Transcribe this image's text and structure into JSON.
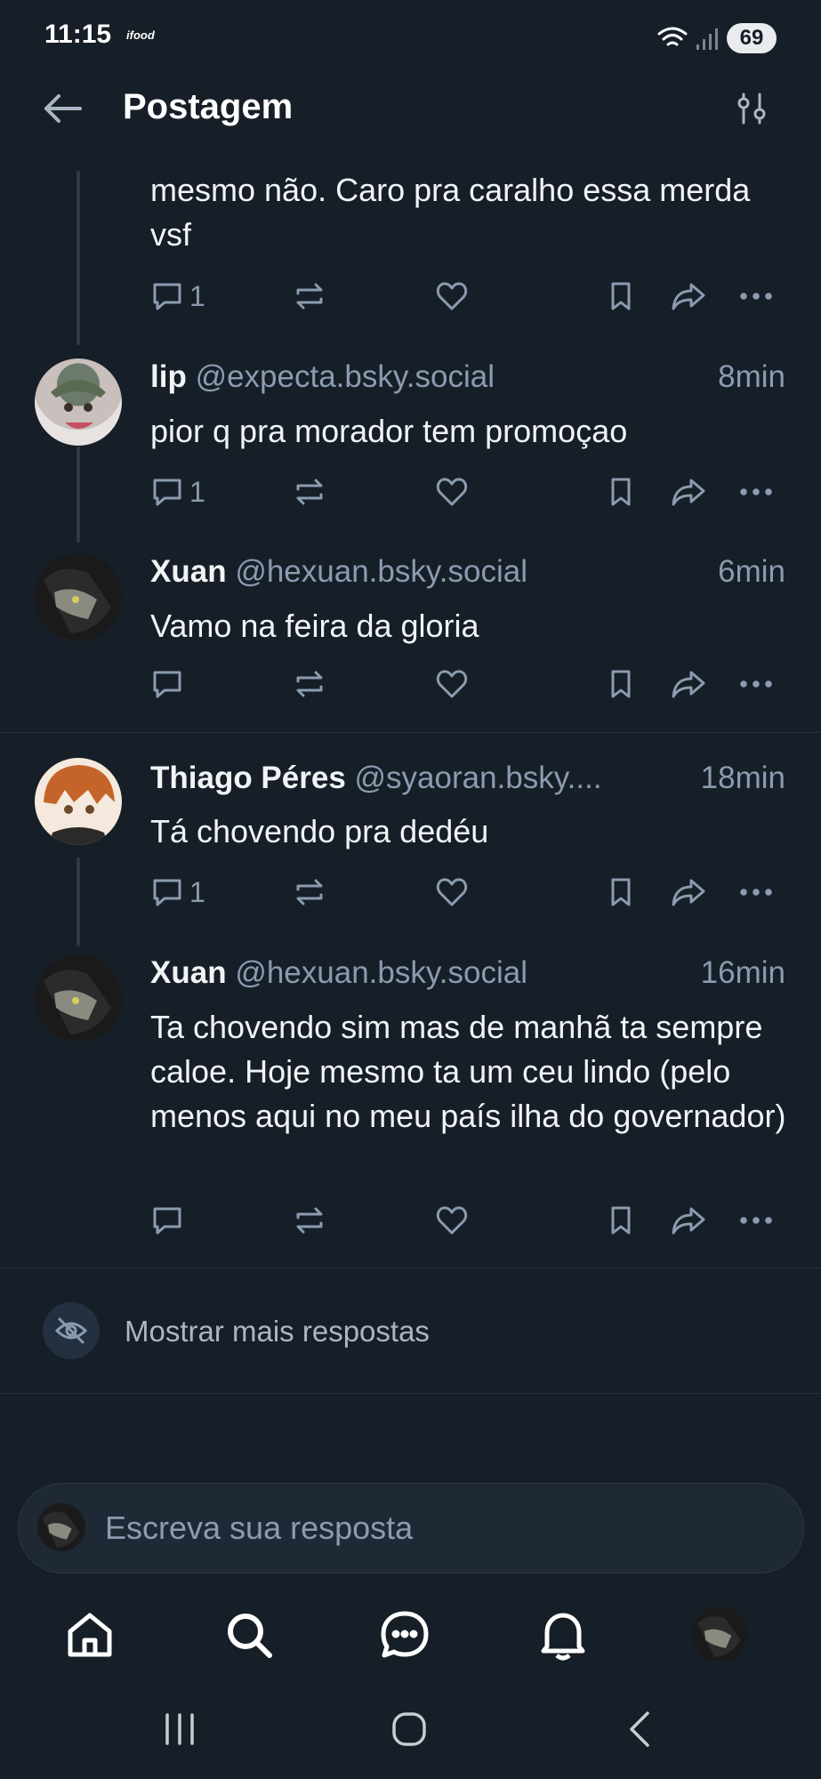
{
  "status_bar": {
    "time": "11:15",
    "app_badge": "ifood",
    "battery": "69"
  },
  "header": {
    "title": "Postagem"
  },
  "posts": [
    {
      "name": "",
      "handle": "",
      "time": "",
      "text": "mesmo não. Caro pra caralho essa merda vsf",
      "reply_count": "1"
    },
    {
      "name": "lip",
      "handle": "@expecta.bsky.social",
      "time": "8min",
      "text": "pior q pra morador tem promoçao",
      "reply_count": "1"
    },
    {
      "name": "Xuan",
      "handle": "@hexuan.bsky.social",
      "time": "6min",
      "text": "Vamo na feira da gloria",
      "reply_count": ""
    },
    {
      "name": "Thiago Péres",
      "handle": "@syaoran.bsky....",
      "time": "18min",
      "text": "Tá chovendo pra dedéu",
      "reply_count": "1"
    },
    {
      "name": "Xuan",
      "handle": "@hexuan.bsky.social",
      "time": "16min",
      "text": "Ta chovendo sim mas de manhã ta sempre caloe. Hoje mesmo ta um ceu lindo (pelo menos aqui no meu país ilha do governador)",
      "reply_count": ""
    }
  ],
  "more_replies": {
    "label": "Mostrar mais respostas"
  },
  "compose": {
    "placeholder": "Escreva sua resposta"
  },
  "colors": {
    "background": "#161e27",
    "text": "#f1f3f5",
    "muted": "#8b9bb0",
    "divider": "#253140"
  },
  "icons": [
    "back-arrow-icon",
    "filter-sliders-icon",
    "reply-icon",
    "repost-icon",
    "like-icon",
    "bookmark-icon",
    "share-icon",
    "more-icon",
    "eye-off-icon",
    "home-icon",
    "search-icon",
    "chat-icon",
    "bell-icon"
  ]
}
